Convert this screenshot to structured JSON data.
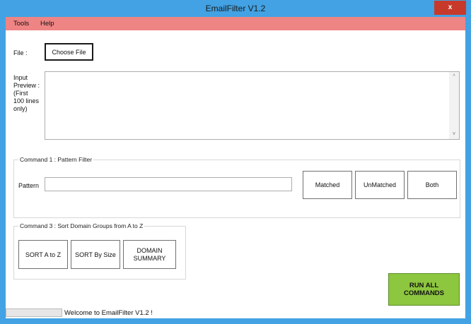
{
  "window": {
    "title": "EmailFilter V1.2",
    "close_glyph": "x"
  },
  "menu": {
    "items": [
      "Tools",
      "Help"
    ]
  },
  "file": {
    "label": "File :",
    "choose_button": "Choose File"
  },
  "preview": {
    "label_lines": [
      "Input",
      "Preview :",
      "(First",
      "100 lines",
      "only)"
    ],
    "scroll_up": "^",
    "scroll_down": "v"
  },
  "command1": {
    "title": "Command 1 : Pattern Filter",
    "pattern_label": "Pattern",
    "pattern_value": "",
    "buttons": [
      "Matched",
      "UnMatched",
      "Both"
    ]
  },
  "command3": {
    "title": "Command 3 : Sort Domain Groups  from A to Z",
    "buttons": [
      "SORT A to Z",
      "SORT By Size",
      "DOMAIN\nSUMMARY"
    ]
  },
  "run": {
    "label_lines": [
      "RUN ALL",
      "COMMANDS"
    ]
  },
  "status": {
    "text": "Welcome to EmailFilter V1.2 !",
    "progress": 0
  },
  "colors": {
    "titlebar": "#42a2e4",
    "menubar": "#ef8484",
    "close": "#c73a2b",
    "run": "#8dc63f"
  }
}
